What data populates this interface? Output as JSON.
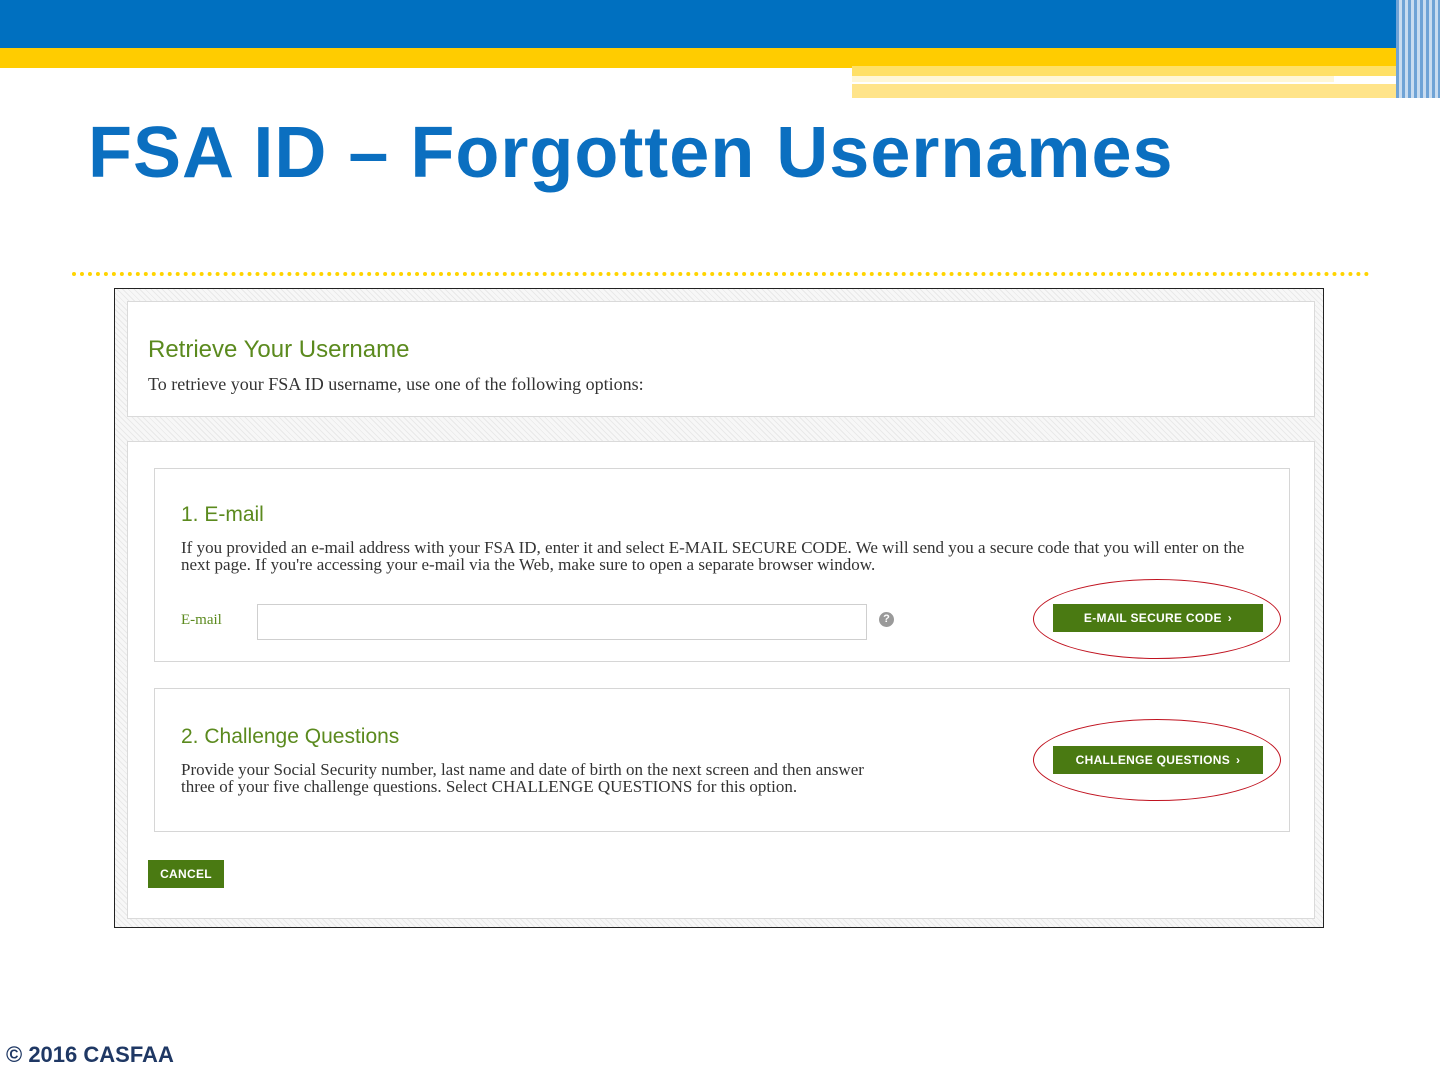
{
  "slide": {
    "title": "FSA ID – Forgotten Usernames",
    "copyright": "© 2016 CASFAA"
  },
  "retrieve": {
    "heading": "Retrieve Your Username",
    "intro": "To retrieve your FSA ID username, use one of the following options:"
  },
  "email_section": {
    "title": "1. E-mail",
    "description": "If you provided an e-mail address with your FSA ID, enter it and select E-MAIL SECURE CODE. We will send you a secure code that you will enter on the next page. If you're accessing your e-mail via the Web, make sure to open a separate browser window.",
    "field_label": "E-mail",
    "field_value": "",
    "help_glyph": "?",
    "button_label": "E-MAIL SECURE CODE"
  },
  "challenge_section": {
    "title": "2. Challenge Questions",
    "description": "Provide your Social Security number, last name and date of birth on the next screen and then answer three of your five challenge questions. Select CHALLENGE QUESTIONS for this option.",
    "button_label": "CHALLENGE QUESTIONS"
  },
  "cancel_label": "CANCEL",
  "chevron": "›",
  "icons": {
    "help": "question-circle-icon",
    "chevron": "chevron-right-icon"
  },
  "colors": {
    "title_blue": "#0b6fc0",
    "accent_green": "#4a7a12",
    "heading_green": "#5b8a1e",
    "annotation_red": "#c0121f"
  }
}
